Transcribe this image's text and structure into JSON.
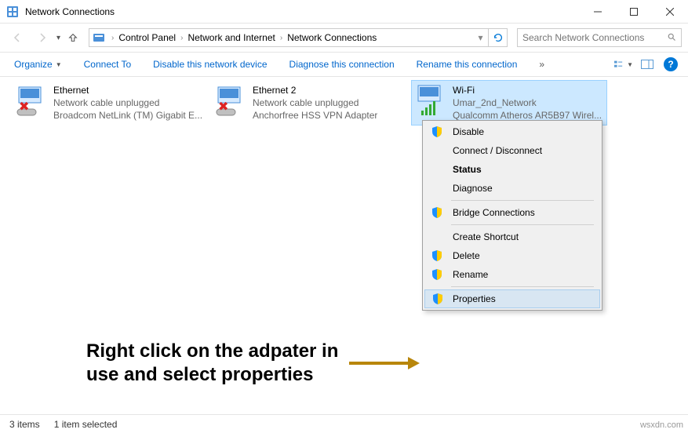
{
  "window": {
    "title": "Network Connections"
  },
  "breadcrumb": {
    "items": [
      "Control Panel",
      "Network and Internet",
      "Network Connections"
    ]
  },
  "search": {
    "placeholder": "Search Network Connections"
  },
  "toolbar": {
    "organize": "Organize",
    "connect_to": "Connect To",
    "disable": "Disable this network device",
    "diagnose": "Diagnose this connection",
    "rename": "Rename this connection",
    "more": "»"
  },
  "adapters": [
    {
      "name": "Ethernet",
      "status": "Network cable unplugged",
      "hw": "Broadcom NetLink (TM) Gigabit E..."
    },
    {
      "name": "Ethernet 2",
      "status": "Network cable unplugged",
      "hw": "Anchorfree HSS VPN Adapter"
    },
    {
      "name": "Wi-Fi",
      "status": "Umar_2nd_Network",
      "hw": "Qualcomm Atheros AR5B97 Wirel..."
    }
  ],
  "context_menu": {
    "disable": "Disable",
    "connect": "Connect / Disconnect",
    "status": "Status",
    "diagnose": "Diagnose",
    "bridge": "Bridge Connections",
    "shortcut": "Create Shortcut",
    "delete": "Delete",
    "rename": "Rename",
    "properties": "Properties"
  },
  "annotation": {
    "text": "Right click on the adpater in use and select properties"
  },
  "statusbar": {
    "count": "3 items",
    "selected": "1 item selected"
  },
  "watermark": "wsxdn.com"
}
